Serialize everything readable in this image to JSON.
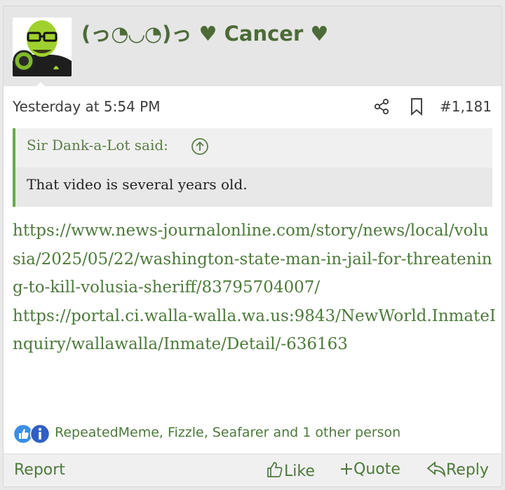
{
  "post": {
    "username": "(っ◔◡◔)っ ♥ Cancer ♥",
    "timestamp": "Yesterday at 5:54 PM",
    "post_number": "#1,181",
    "quote": {
      "author": "Sir Dank-a-Lot said:",
      "text": "That video is several years old."
    },
    "links": [
      "https://www.news-journalonline.com/story/news/local/volusia/2025/05/22/washington-state-man-in-jail-for-threatening-to-kill-volusia-sheriff/83795704007/",
      "https://portal.ci.walla-walla.wa.us:9843/NewWorld.InmateInquiry/wallawalla/Inmate/Detail/-636163"
    ],
    "reactions": {
      "icons": [
        "like-reaction-icon",
        "info-reaction-icon"
      ],
      "text": "RepeatedMeme, Fizzle, Seafarer and 1 other person"
    },
    "footer": {
      "report": "Report",
      "like": "Like",
      "quote": "Quote",
      "reply": "Reply"
    }
  },
  "colors": {
    "accent": "#4c7a3a",
    "username": "#4c6b38",
    "quote_bar": "#6aa84f",
    "header_bg": "#e6e6e6"
  }
}
